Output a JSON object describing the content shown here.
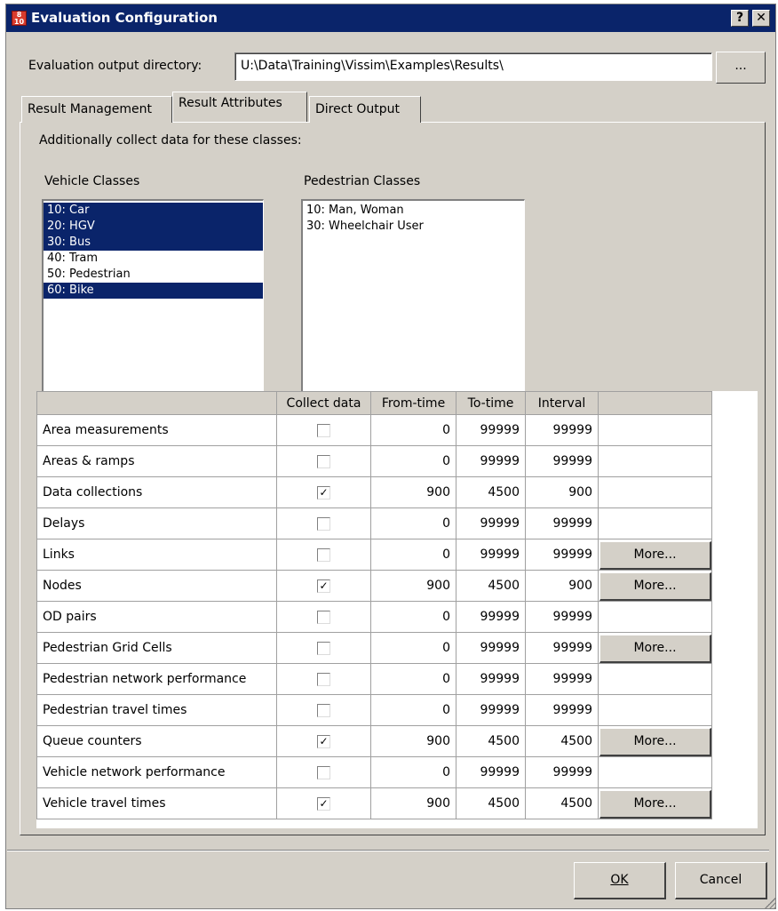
{
  "window": {
    "title": "Evaluation Configuration",
    "help_label": "?",
    "close_label": "✕",
    "icon_name": "vissim-app-icon"
  },
  "output": {
    "label": "Evaluation output directory:",
    "value": "U:\\Data\\Training\\Vissim\\Examples\\Results\\",
    "browse_label": "..."
  },
  "tabs": [
    {
      "label": "Result Management",
      "active": false
    },
    {
      "label": "Result Attributes",
      "active": true
    },
    {
      "label": "Direct Output",
      "active": false
    }
  ],
  "classes": {
    "heading": "Additionally collect data for these classes:",
    "vehicle_label": "Vehicle Classes",
    "pedestrian_label": "Pedestrian Classes",
    "vehicle": [
      {
        "label": "10: Car",
        "selected": true
      },
      {
        "label": "20: HGV",
        "selected": true
      },
      {
        "label": "30: Bus",
        "selected": true
      },
      {
        "label": "40: Tram",
        "selected": false
      },
      {
        "label": "50: Pedestrian",
        "selected": false
      },
      {
        "label": "60: Bike",
        "selected": true
      }
    ],
    "pedestrian": [
      {
        "label": "10: Man, Woman",
        "selected": false
      },
      {
        "label": "30: Wheelchair User",
        "selected": false
      }
    ]
  },
  "table": {
    "headers": [
      "",
      "Collect data",
      "From-time",
      "To-time",
      "Interval",
      ""
    ],
    "rows": [
      {
        "name": "Area measurements",
        "collect": false,
        "from": "0",
        "to": "99999",
        "interval": "99999",
        "more": ""
      },
      {
        "name": "Areas & ramps",
        "collect": false,
        "from": "0",
        "to": "99999",
        "interval": "99999",
        "more": ""
      },
      {
        "name": "Data collections",
        "collect": true,
        "from": "900",
        "to": "4500",
        "interval": "900",
        "more": ""
      },
      {
        "name": "Delays",
        "collect": false,
        "from": "0",
        "to": "99999",
        "interval": "99999",
        "more": ""
      },
      {
        "name": "Links",
        "collect": false,
        "from": "0",
        "to": "99999",
        "interval": "99999",
        "more": "More..."
      },
      {
        "name": "Nodes",
        "collect": true,
        "from": "900",
        "to": "4500",
        "interval": "900",
        "more": "More..."
      },
      {
        "name": "OD pairs",
        "collect": false,
        "from": "0",
        "to": "99999",
        "interval": "99999",
        "more": ""
      },
      {
        "name": "Pedestrian Grid Cells",
        "collect": false,
        "from": "0",
        "to": "99999",
        "interval": "99999",
        "more": "More..."
      },
      {
        "name": "Pedestrian network performance",
        "collect": false,
        "from": "0",
        "to": "99999",
        "interval": "99999",
        "more": ""
      },
      {
        "name": "Pedestrian travel times",
        "collect": false,
        "from": "0",
        "to": "99999",
        "interval": "99999",
        "more": ""
      },
      {
        "name": "Queue counters",
        "collect": true,
        "from": "900",
        "to": "4500",
        "interval": "4500",
        "more": "More..."
      },
      {
        "name": "Vehicle network performance",
        "collect": false,
        "from": "0",
        "to": "99999",
        "interval": "99999",
        "more": ""
      },
      {
        "name": "Vehicle travel times",
        "collect": true,
        "from": "900",
        "to": "4500",
        "interval": "4500",
        "more": "More..."
      }
    ]
  },
  "buttons": {
    "ok": "OK",
    "cancel": "Cancel"
  },
  "colors": {
    "titlebar": "#0a246a",
    "selection": "#0a246a",
    "face": "#d4d0c8"
  }
}
